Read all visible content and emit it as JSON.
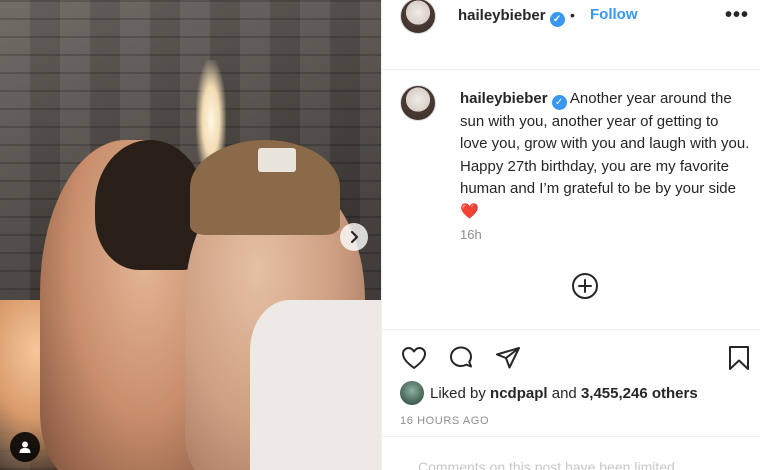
{
  "post": {
    "username": "haileybieber",
    "dot": "•",
    "follow_label": "Follow",
    "more_label": "•••",
    "caption_text": "Another year around the sun with you, another year of getting to love you, grow with you and laugh with you. Happy 27th birthday, you are my favorite human and I’m grateful to be by your side",
    "caption_emoji": "❤️",
    "time_ago": "16h",
    "likes": {
      "prefix": "Liked by",
      "user": "ncdpapl",
      "conjunction": "and",
      "count": "3,455,246 others"
    },
    "date_label": "16 HOURS AGO",
    "comments_notice": "Comments on this post have been limited."
  },
  "colors": {
    "accent": "#3897f0",
    "text": "#262626",
    "muted": "#8e8e8e",
    "heart": "#e0245e"
  },
  "icons": {
    "like": "heart-outline-icon",
    "comment": "comment-bubble-icon",
    "share": "paper-plane-icon",
    "save": "bookmark-icon",
    "add_comment": "plus-circle-icon",
    "next": "chevron-right-icon",
    "tag": "user-tag-icon"
  }
}
